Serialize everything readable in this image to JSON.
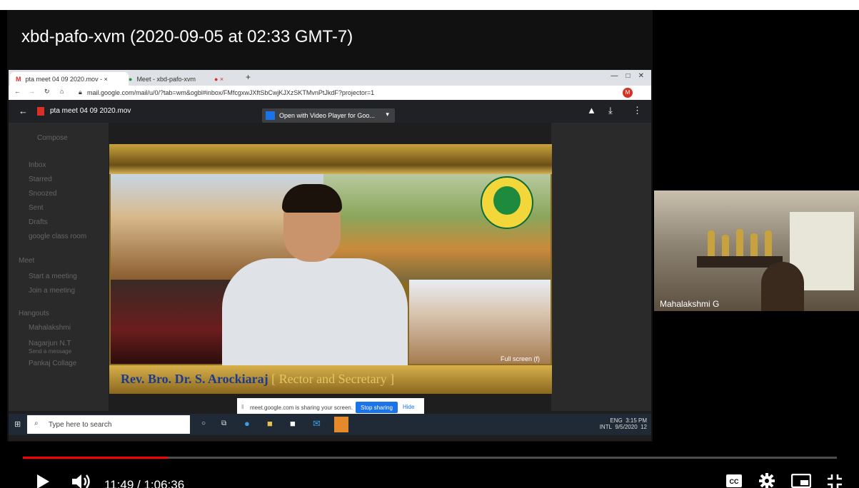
{
  "video": {
    "title": "xbd-pafo-xvm (2020-09-05 at 02:33 GMT-7)",
    "current_time": "11:49",
    "duration": "1:06:36",
    "time_display": "11:49 / 1:06:36",
    "progress_fraction": 0.178
  },
  "participant": {
    "name": "Mahalakshmi G"
  },
  "shared_screen": {
    "tabs": [
      {
        "label": "pta meet 04 09 2020.mov - ×"
      },
      {
        "label": "Meet - xbd-pafo-xvm"
      }
    ],
    "url": "mail.google.com/mail/u/0/?tab=wm&ogbl#inbox/FMfcgxwJXftSbCwjKJXzSKTMvnPtJkdF?projector=1",
    "file_name": "pta meet 04 09 2020.mov",
    "open_with": "Open with Video Player for Goo...",
    "sidebar": {
      "compose": "Compose",
      "items": [
        "Inbox",
        "Starred",
        "Snoozed",
        "Sent",
        "Drafts",
        "google class room"
      ],
      "meet_header": "Meet",
      "meet_items": [
        "Start a meeting",
        "Join a meeting"
      ],
      "hangouts_header": "Hangouts",
      "hangouts_items": [
        "Mahalakshmi",
        "Nagarjun N.T",
        "Send a message",
        "Pankaj Collage"
      ]
    },
    "video_caption": "Rev. Bro. Dr. S. Arockiaraj",
    "video_caption_role": "[ Rector and Secretary ]",
    "fullscreen_hint": "Full screen (f)",
    "sharing_notice": "meet.google.com is sharing your screen.",
    "stop_sharing": "Stop sharing",
    "hide": "Hide",
    "taskbar_search": "Type here to search",
    "tray_lang": "ENG",
    "tray_region": "INTL",
    "tray_time": "3:15 PM",
    "tray_date": "9/5/2020",
    "notification_count": "12"
  },
  "colors": {
    "progress": "#ff0000",
    "accent_blue": "#1a73e8"
  }
}
